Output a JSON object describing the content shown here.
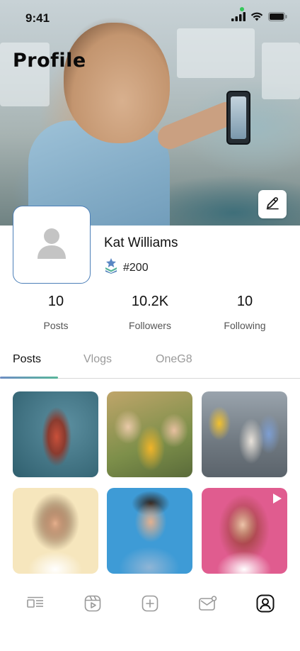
{
  "status_bar": {
    "time": "9:41"
  },
  "header": {
    "title": "Profile"
  },
  "profile": {
    "name": "Kat Williams",
    "rank": "#200"
  },
  "stats": [
    {
      "value": "10",
      "label": "Posts"
    },
    {
      "value": "10.2K",
      "label": "Followers"
    },
    {
      "value": "10",
      "label": "Following"
    }
  ],
  "tabs": [
    {
      "label": "Posts",
      "active": true
    },
    {
      "label": "Vlogs",
      "active": false
    },
    {
      "label": "OneG8",
      "active": false
    }
  ],
  "colors": {
    "accent_blue": "#4c7fb8",
    "tab_gradient_start": "#6e8ec4",
    "tab_gradient_end": "#58b59a",
    "rank_icon": "#5a87c4"
  },
  "posts": [
    {
      "type": "photo",
      "icon": ""
    },
    {
      "type": "photo",
      "icon": ""
    },
    {
      "type": "photo",
      "icon": ""
    },
    {
      "type": "photo",
      "icon": ""
    },
    {
      "type": "photo",
      "icon": ""
    },
    {
      "type": "video",
      "icon": "play-icon"
    }
  ],
  "bottom_nav": [
    "feed-icon",
    "reels-icon",
    "add-icon",
    "inbox-icon",
    "profile-icon"
  ]
}
